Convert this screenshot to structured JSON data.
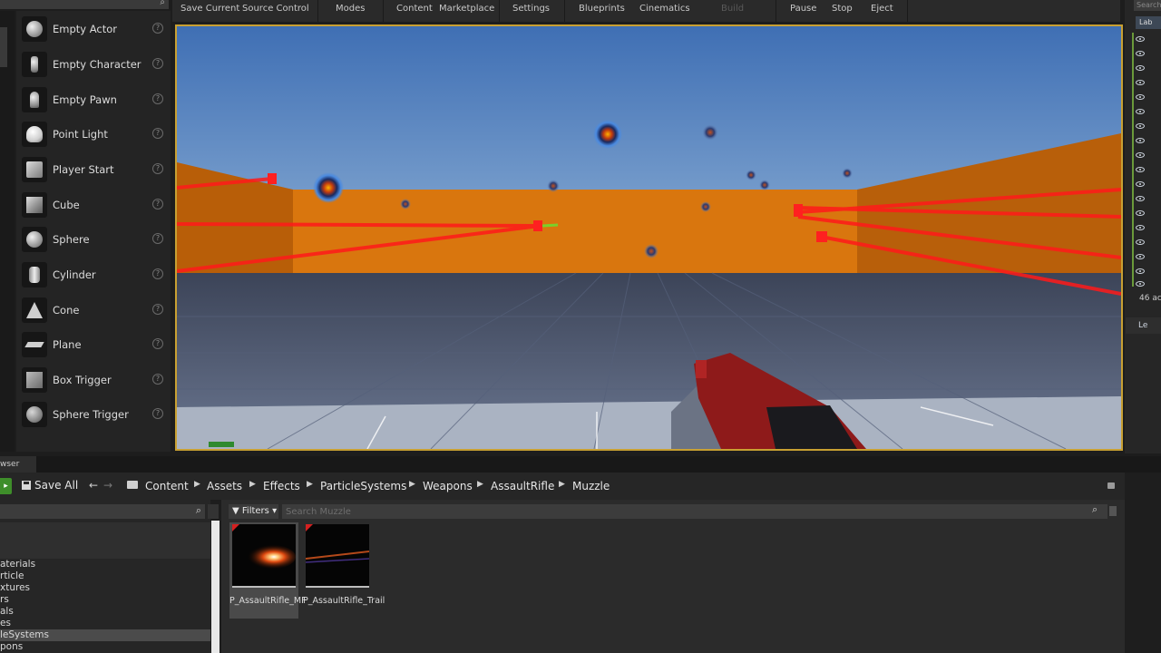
{
  "toolbar": {
    "save_current": "Save Current",
    "source_control": "Source Control",
    "modes": "Modes",
    "content": "Content",
    "marketplace": "Marketplace",
    "settings": "Settings",
    "blueprints": "Blueprints",
    "cinematics": "Cinematics",
    "build": "Build",
    "pause": "Pause",
    "stop": "Stop",
    "eject": "Eject"
  },
  "place_panel": {
    "items": [
      {
        "label": "Empty Actor",
        "icon": "sphere-icon"
      },
      {
        "label": "Empty Character",
        "icon": "character-icon"
      },
      {
        "label": "Empty Pawn",
        "icon": "pawn-icon"
      },
      {
        "label": "Point Light",
        "icon": "point-light-icon"
      },
      {
        "label": "Player Start",
        "icon": "player-start-icon"
      },
      {
        "label": "Cube",
        "icon": "cube-icon"
      },
      {
        "label": "Sphere",
        "icon": "sphere-icon"
      },
      {
        "label": "Cylinder",
        "icon": "cylinder-icon"
      },
      {
        "label": "Cone",
        "icon": "cone-icon"
      },
      {
        "label": "Plane",
        "icon": "plane-icon"
      },
      {
        "label": "Box Trigger",
        "icon": "box-trigger-icon"
      },
      {
        "label": "Sphere Trigger",
        "icon": "sphere-trigger-icon"
      }
    ],
    "help_glyph": "?"
  },
  "outliner": {
    "search_placeholder": "Search",
    "tab_label": "Lab",
    "actor_count": "46 ac",
    "lower_tab": "Le"
  },
  "content_browser": {
    "tab_label": "wser",
    "add_glyph": "▸",
    "save_all": "Save All",
    "breadcrumb": [
      "Content",
      "Assets",
      "Effects",
      "ParticleSystems",
      "Weapons",
      "AssaultRifle",
      "Muzzle"
    ],
    "filters_label": "Filters",
    "search_placeholder": "Search Muzzle",
    "folders": [
      {
        "label": "aterials",
        "selected": false
      },
      {
        "label": "rticle",
        "selected": false
      },
      {
        "label": "xtures",
        "selected": false
      },
      {
        "label": "rs",
        "selected": false
      },
      {
        "label": "als",
        "selected": false
      },
      {
        "label": "es",
        "selected": false
      },
      {
        "label": "leSystems",
        "selected": true
      },
      {
        "label": "pons",
        "selected": false
      }
    ],
    "assets": [
      {
        "name": "P_AssaultRifle_MF",
        "selected": true,
        "kind": "muzzle-flash"
      },
      {
        "name": "P_AssaultRifle_Trail",
        "selected": false,
        "kind": "trail"
      }
    ]
  },
  "colors": {
    "viewport_border": "#c8a032",
    "wall_orange": "#d9760e",
    "laser_red": "#ff1a1a",
    "add_green": "#3e8e2a"
  }
}
